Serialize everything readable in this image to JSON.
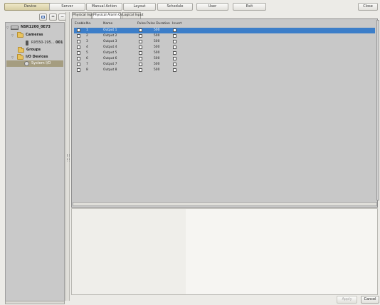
{
  "toolbar": {
    "buttons": [
      "Device",
      "Server",
      "Manual Action",
      "Layout",
      "Schedule",
      "User",
      "Exit"
    ],
    "close_label": "Close"
  },
  "side_tools": {
    "collapse_label": "=",
    "minus_label": "−"
  },
  "tree": {
    "root": "NSR1200_0E73",
    "cameras_label": "Cameras",
    "camera_name": "RX550-195...",
    "camera_channel": "001",
    "groups_label": "Groups",
    "io_devices_label": "I/O Devices",
    "system_io_label": "System I/O"
  },
  "tabs": [
    "Physical Input",
    "Physical Alarm Out",
    "Logical Input"
  ],
  "table": {
    "columns": [
      "Enable",
      "No.",
      "Name",
      "Pulse",
      "Pulse Duration",
      "Invert"
    ],
    "rows": [
      {
        "no": "1",
        "name": "Output 1",
        "duration": "500"
      },
      {
        "no": "2",
        "name": "Output 2",
        "duration": "500"
      },
      {
        "no": "3",
        "name": "Output 3",
        "duration": "500"
      },
      {
        "no": "4",
        "name": "Output 4",
        "duration": "500"
      },
      {
        "no": "5",
        "name": "Output 5",
        "duration": "500"
      },
      {
        "no": "6",
        "name": "Output 6",
        "duration": "500"
      },
      {
        "no": "7",
        "name": "Output 7",
        "duration": "500"
      },
      {
        "no": "8",
        "name": "Output 8",
        "duration": "500"
      }
    ]
  },
  "bottom": {
    "apply_label": "Apply",
    "cancel_label": "Cancel"
  },
  "colors": {
    "selection": "#3c7ec9",
    "active_button": "#e3dbb6",
    "tree_selection": "#a59d80"
  }
}
